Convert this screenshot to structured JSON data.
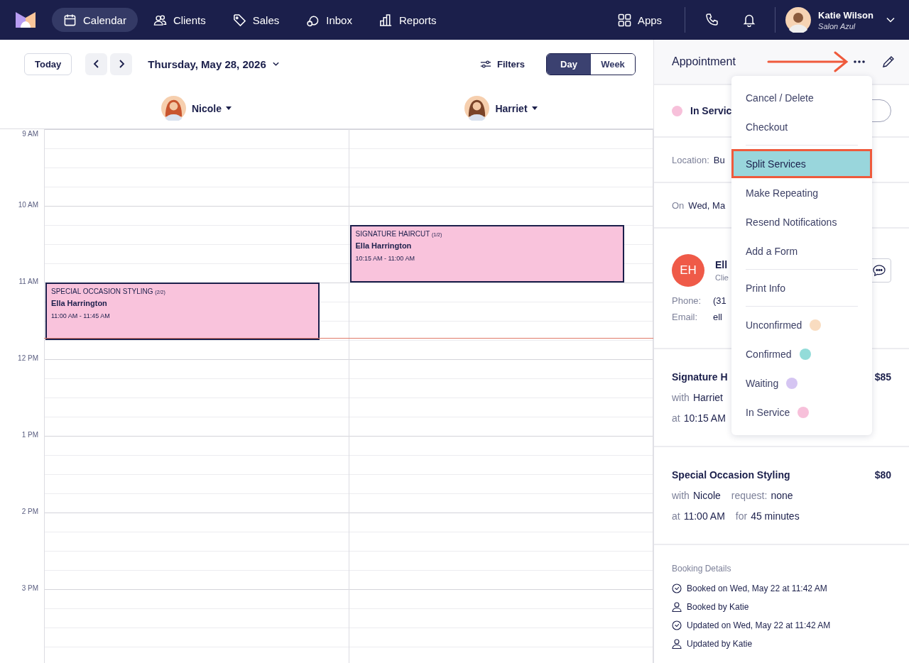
{
  "nav": {
    "items": [
      {
        "label": "Calendar",
        "selected": true
      },
      {
        "label": "Clients",
        "selected": false
      },
      {
        "label": "Sales",
        "selected": false
      },
      {
        "label": "Inbox",
        "selected": false
      },
      {
        "label": "Reports",
        "selected": false
      }
    ],
    "apps": "Apps",
    "user": {
      "name": "Katie Wilson",
      "business": "Salon Azul"
    }
  },
  "toolbar": {
    "today": "Today",
    "date": "Thursday, May 28, 2026",
    "filters": "Filters",
    "views": [
      {
        "label": "Day",
        "selected": true
      },
      {
        "label": "Week",
        "selected": false
      }
    ]
  },
  "hours": [
    "9 AM",
    "10 AM",
    "11 AM",
    "12 PM",
    "1 PM",
    "2 PM",
    "3 PM"
  ],
  "staff": [
    {
      "name": "Nicole",
      "appointments": [
        {
          "service": "SPECIAL OCCASION STYLING",
          "part": "(2/2)",
          "client": "Ella Harrington",
          "time": "11:00 AM - 11:45 AM",
          "color": "#f9c3dc"
        }
      ]
    },
    {
      "name": "Harriet",
      "appointments": [
        {
          "service": "SIGNATURE HAIRCUT",
          "part": "(1/2)",
          "client": "Ella Harrington",
          "time": "10:15 AM - 11:00 AM",
          "color": "#f9c3dc"
        }
      ]
    }
  ],
  "panel": {
    "title": "Appointment",
    "status": {
      "label": "In Servic",
      "color": "#f7c0da"
    },
    "location": {
      "label": "Location:",
      "value": "Bu"
    },
    "date": {
      "label": "On",
      "value": "Wed, Ma"
    },
    "client": {
      "initials": "EH",
      "name": "Ell",
      "subtitle": "Clie",
      "phone_label": "Phone:",
      "phone": "(31",
      "email_label": "Email:",
      "email": "ell"
    },
    "services": [
      {
        "name": "Signature H",
        "price": "$85",
        "with_label": "with",
        "staff": "Harriet",
        "at_label": "at",
        "time": "10:15 AM"
      },
      {
        "name": "Special Occasion Styling",
        "price": "$80",
        "with_label": "with",
        "staff": "Nicole",
        "request_label": "request:",
        "request": "none",
        "at_label": "at",
        "time": "11:00 AM",
        "for_label": "for",
        "duration": "45 minutes"
      }
    ],
    "booking": {
      "title": "Booking Details",
      "entries": [
        {
          "kind": "clock",
          "text": "Booked on Wed, May 22 at 11:42 AM"
        },
        {
          "kind": "person",
          "text": "Booked by Katie"
        },
        {
          "kind": "clock",
          "text": "Updated on Wed, May 22 at 11:42 AM"
        },
        {
          "kind": "person",
          "text": "Updated by Katie"
        }
      ]
    }
  },
  "menu": {
    "groups": [
      [
        {
          "label": "Cancel / Delete",
          "selected": false
        },
        {
          "label": "Checkout",
          "selected": false
        }
      ],
      [
        {
          "label": "Split Services",
          "selected": true
        },
        {
          "label": "Make Repeating",
          "selected": false
        },
        {
          "label": "Resend Notifications",
          "selected": false
        },
        {
          "label": "Add a Form",
          "selected": false
        }
      ],
      [
        {
          "label": "Print Info",
          "selected": false
        }
      ],
      [
        {
          "label": "Unconfirmed",
          "selected": false,
          "color": "#f9dcc0"
        },
        {
          "label": "Confirmed",
          "selected": false,
          "color": "#93dcd9"
        },
        {
          "label": "Waiting",
          "selected": false,
          "color": "#d5c5f2"
        },
        {
          "label": "In Service",
          "selected": false,
          "color": "#f7c0da"
        }
      ]
    ]
  }
}
